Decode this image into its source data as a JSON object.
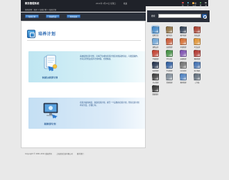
{
  "topbar": {
    "title": "教务管理系统",
    "clock": "2011年 3月13日 星期日",
    "welcome": "欢迎",
    "links": [
      {
        "label": "首页",
        "icon": "home-icon",
        "color": "#d9534f"
      },
      {
        "label": "个人",
        "icon": "user-icon",
        "color": "#5bc0de"
      },
      {
        "label": "修改密码",
        "icon": "key-icon",
        "color": "#f0ad4e"
      },
      {
        "label": "帮助",
        "icon": "help-icon",
        "color": "#5cb85c"
      },
      {
        "label": "退出",
        "icon": "exit-icon",
        "color": "#999999"
      }
    ]
  },
  "breadcrumb": "您的位置：首页 > 培养计划 > 培养计划",
  "search": {
    "label": "搜索",
    "placeholder": ""
  },
  "tabs": [
    {
      "label": "培养计划",
      "active": true
    },
    {
      "label": "快速生成"
    },
    {
      "label": "所有培养"
    }
  ],
  "main": {
    "title": "培养计划",
    "cards": [
      {
        "label": "快速生成培养计划",
        "desc": "系统提供培养计划、可将已生成的培养计划应用到其他专业，可批量操作，也可自行修改培养计划内容，方便快捷。"
      },
      {
        "label": "新建培养计划",
        "desc": "培养方案的制定，新建培养计划，填写一个完整的培养计划，所有培养计划均可导出，方便打印。"
      }
    ]
  },
  "footer": {
    "copyright": "Copyright © 2001-2011 版权所有",
    "company": "上海某某信息有限公司",
    "link": "联系我们"
  },
  "grid_items": [
    {
      "label": "招聘计划",
      "color": "#3b86c9",
      "sel": true
    },
    {
      "label": "教学任务",
      "color": "#8a6b3b"
    },
    {
      "label": "教学管理",
      "color": "#2b3a4f"
    },
    {
      "label": "系统设置",
      "color": "#a83a2a"
    },
    {
      "label": "课程安排",
      "color": "#6aa3d6"
    },
    {
      "label": "成绩管理",
      "color": "#c9542f"
    },
    {
      "label": "排课管理",
      "color": "#d66a2a"
    },
    {
      "label": "考试安排",
      "color": "#e0912d"
    },
    {
      "label": "学籍管理",
      "color": "#c23b2b"
    },
    {
      "label": "学生信息",
      "color": "#3d8d3d"
    },
    {
      "label": "选课管理",
      "color": "#7a4bb0"
    },
    {
      "label": "教室管理",
      "color": "#b0322c"
    },
    {
      "label": "实验管理",
      "color": "#1d2c47"
    },
    {
      "label": "毕业管理",
      "color": "#2a5a9e"
    },
    {
      "label": "综合查询",
      "color": "#6e6e6e"
    },
    {
      "label": "统计报表",
      "color": "#3d6db0"
    },
    {
      "label": "评价管理",
      "color": "#3a3a3a"
    },
    {
      "label": "资源管理",
      "color": "#7d8a97"
    },
    {
      "label": "教材管理",
      "color": "#4a7fc1"
    },
    {
      "label": "工作量",
      "color": "#5e6c7a"
    },
    {
      "label": "数据备份",
      "color": "#2e2e2e"
    }
  ]
}
